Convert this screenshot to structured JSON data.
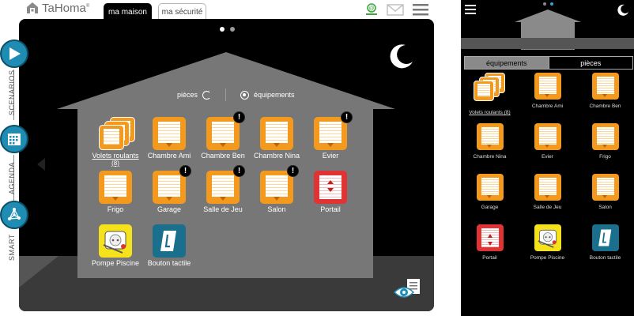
{
  "app": {
    "name": "TaHoma",
    "trademark": "®"
  },
  "tabs": [
    {
      "label": "ma maison",
      "active": true
    },
    {
      "label": "ma sécurité",
      "active": false
    }
  ],
  "side_nav": [
    {
      "label": "SCENARIOS",
      "icon": "play-icon"
    },
    {
      "label": "AGENDA",
      "icon": "calendar-icon"
    },
    {
      "label": "SMART",
      "icon": "network-icon"
    }
  ],
  "view_toggle": {
    "rooms": "pièces",
    "equipment": "équipements",
    "selected": "équipements"
  },
  "pager": {
    "pages": 2,
    "current": 1
  },
  "devices": [
    {
      "label": "Volets roulants",
      "sub": "(8)",
      "type": "shutter-group",
      "alert": false
    },
    {
      "label": "Chambre Ami",
      "type": "shutter",
      "alert": false
    },
    {
      "label": "Chambre Ben",
      "type": "shutter",
      "alert": true
    },
    {
      "label": "Chambre Nina",
      "type": "shutter",
      "alert": false
    },
    {
      "label": "Evier",
      "type": "shutter",
      "alert": true
    },
    {
      "label": "Frigo",
      "type": "shutter",
      "alert": false
    },
    {
      "label": "Garage",
      "type": "shutter",
      "alert": true
    },
    {
      "label": "Salle de Jeu",
      "type": "shutter",
      "alert": true
    },
    {
      "label": "Salon",
      "type": "shutter",
      "alert": true
    },
    {
      "label": "Portail",
      "type": "gate",
      "alert": false
    },
    {
      "label": "Pompe Piscine",
      "type": "plug",
      "alert": false
    },
    {
      "label": "Bouton tactile",
      "type": "touch-button",
      "alert": false
    }
  ],
  "alert_glyph": "!",
  "phone": {
    "tabs": [
      {
        "label": "équipements",
        "active": true
      },
      {
        "label": "pièces",
        "active": false
      }
    ],
    "devices": [
      {
        "label": "Volets roulants (8)",
        "type": "shutter-group"
      },
      {
        "label": "Chambre Ami",
        "type": "shutter"
      },
      {
        "label": "Chambre Ben",
        "type": "shutter"
      },
      {
        "label": "Chambre Nina",
        "type": "shutter"
      },
      {
        "label": "Evier",
        "type": "shutter"
      },
      {
        "label": "Frigo",
        "type": "shutter"
      },
      {
        "label": "Garage",
        "type": "shutter"
      },
      {
        "label": "Salle de Jeu",
        "type": "shutter"
      },
      {
        "label": "Salon",
        "type": "shutter"
      },
      {
        "label": "Portail",
        "type": "gate"
      },
      {
        "label": "Pompe Piscine",
        "type": "plug"
      },
      {
        "label": "Bouton tactile",
        "type": "touch-button"
      }
    ]
  },
  "colors": {
    "shutter": "#f39a1e",
    "gate": "#e03434",
    "plug": "#f6e21c",
    "touch": "#1a6f8c",
    "nav": "#1f8cb3",
    "phone_active_dot": "#2aa7d6"
  }
}
